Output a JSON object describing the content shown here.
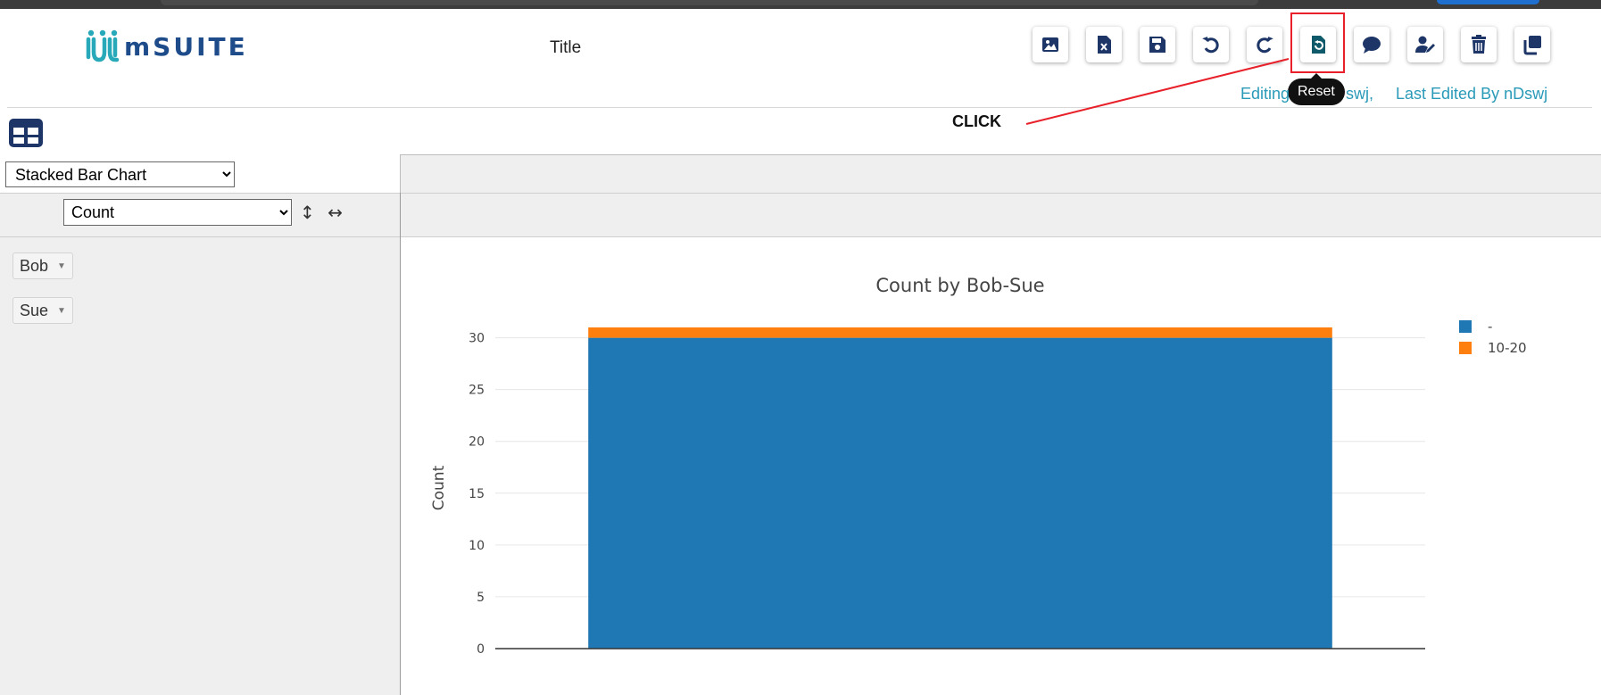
{
  "app": {
    "logo_text": "mSUITE",
    "title": "Title"
  },
  "toolbar": {
    "buttons": [
      {
        "name": "image-export",
        "icon": "image-icon"
      },
      {
        "name": "excel-export",
        "icon": "excel-file-icon"
      },
      {
        "name": "save",
        "icon": "floppy-disk-icon"
      },
      {
        "name": "undo",
        "icon": "undo-icon"
      },
      {
        "name": "redo",
        "icon": "redo-icon"
      },
      {
        "name": "reset",
        "icon": "reset-icon"
      },
      {
        "name": "comment",
        "icon": "comment-icon"
      },
      {
        "name": "edit-user",
        "icon": "user-edit-icon"
      },
      {
        "name": "delete",
        "icon": "trash-icon"
      },
      {
        "name": "copy",
        "icon": "copy-icon"
      }
    ],
    "tooltip": "Reset",
    "icon_color": "#1d3567",
    "highlight_color": "#e8202a"
  },
  "status": {
    "editing": "Editing",
    "editing_user": "swj,",
    "last_edited": "Last Edited By nDswj"
  },
  "annotation": {
    "click_label": "CLICK"
  },
  "controls": {
    "chart_type": "Stacked Bar Chart",
    "aggregator": "Count",
    "sort_icons": "↕ ↔",
    "attributes": [
      "Bob",
      "Sue"
    ]
  },
  "chart_data": {
    "type": "bar",
    "stacked": true,
    "title": "Count by Bob-Sue",
    "xlabel": "",
    "ylabel": "Count",
    "categories": [
      ""
    ],
    "series": [
      {
        "name": "-",
        "values": [
          30
        ],
        "color": "#1f77b4"
      },
      {
        "name": "10-20",
        "values": [
          1
        ],
        "color": "#ff7f0e"
      }
    ],
    "ylim": [
      0,
      31
    ],
    "yticks": [
      0,
      5,
      10,
      15,
      20,
      25,
      30
    ],
    "grid": true,
    "legend": "top-right"
  }
}
